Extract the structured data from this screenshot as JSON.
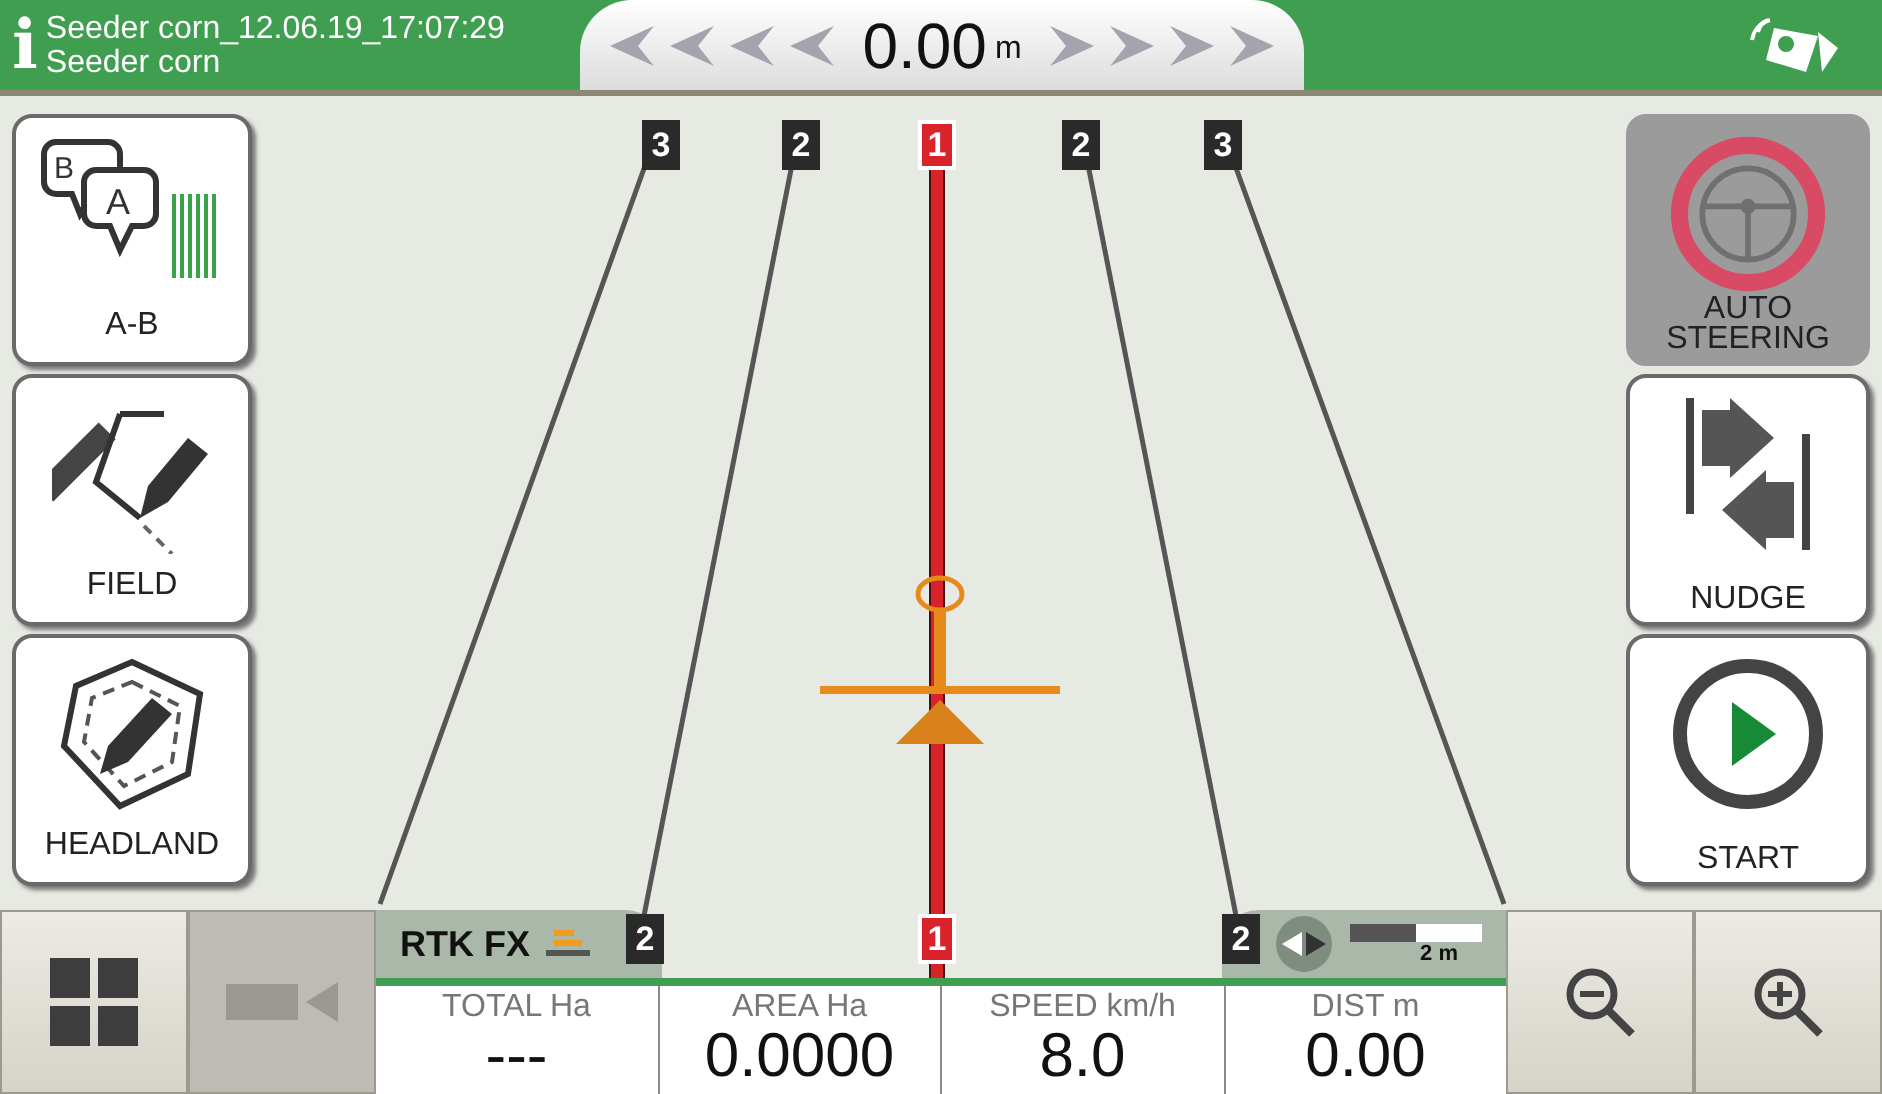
{
  "header": {
    "info_icon": "i",
    "job_name": "Seeder corn_12.06.19_17:07:29",
    "implement": "Seeder corn",
    "offset_value": "0.00",
    "offset_unit": "m"
  },
  "top_markers": [
    {
      "label": "3",
      "kind": "guide"
    },
    {
      "label": "2",
      "kind": "guide"
    },
    {
      "label": "1",
      "kind": "current"
    },
    {
      "label": "2",
      "kind": "guide"
    },
    {
      "label": "3",
      "kind": "guide"
    }
  ],
  "left_buttons": [
    {
      "label": "A-B",
      "kind": "ab",
      "icon_letters": [
        "B",
        "A"
      ]
    },
    {
      "label": "FIELD",
      "kind": "field"
    },
    {
      "label": "HEADLAND",
      "kind": "headland"
    }
  ],
  "right_buttons": [
    {
      "label": "AUTO STEERING",
      "kind": "steering",
      "disabled": true
    },
    {
      "label": "NUDGE",
      "kind": "nudge",
      "disabled": false
    },
    {
      "label": "START",
      "kind": "start",
      "disabled": false
    }
  ],
  "status_strip": {
    "gps_status": "RTK FX",
    "scale_label": "2 m"
  },
  "bottom_markers": [
    {
      "label": "2",
      "kind": "guide"
    },
    {
      "label": "1",
      "kind": "current"
    },
    {
      "label": "2",
      "kind": "guide"
    }
  ],
  "bottom_buttons": [
    {
      "kind": "menu",
      "disabled": false
    },
    {
      "kind": "camera",
      "disabled": true
    },
    {
      "kind": "zoom_out",
      "disabled": false
    },
    {
      "kind": "zoom_in",
      "disabled": false
    }
  ],
  "readouts": [
    {
      "label": "TOTAL Ha",
      "value": "---"
    },
    {
      "label": "AREA Ha",
      "value": "0.0000"
    },
    {
      "label": "SPEED km/h",
      "value": "8.0"
    },
    {
      "label": "DIST m",
      "value": "0.00"
    }
  ]
}
